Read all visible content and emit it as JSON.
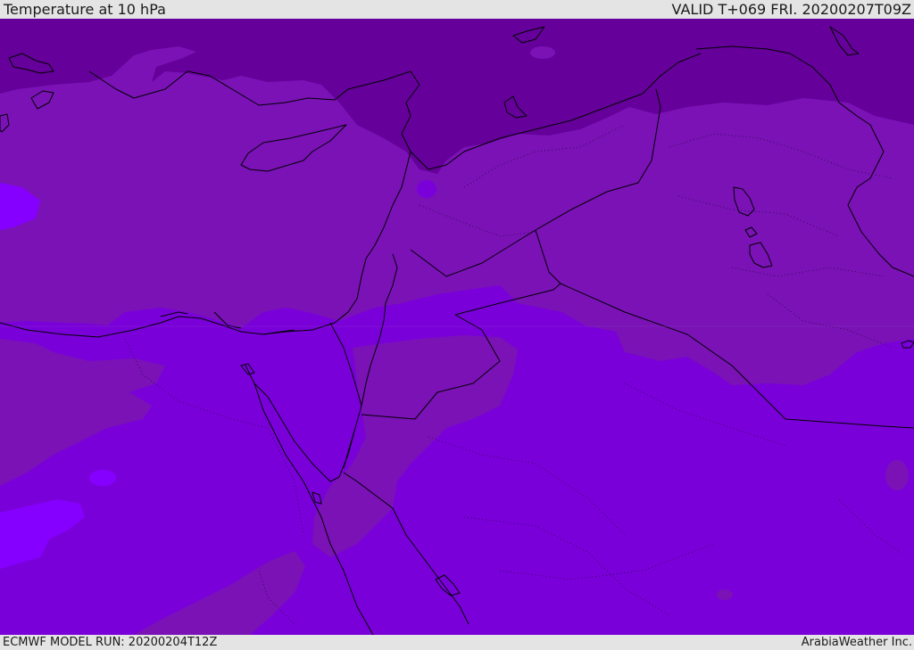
{
  "header": {
    "title": "Temperature at 10 hPa",
    "valid": "VALID T+069 FRI. 20200207T09Z"
  },
  "footer": {
    "model_run": "ECMWF MODEL RUN: 20200204T12Z",
    "credit": "ArabiaWeather Inc."
  },
  "colors": {
    "band_coldest": "#65009a",
    "band_cold": "#7a12b6",
    "band_mid": "#7a00da",
    "band_warm": "#8600ff",
    "border": "#000000"
  }
}
